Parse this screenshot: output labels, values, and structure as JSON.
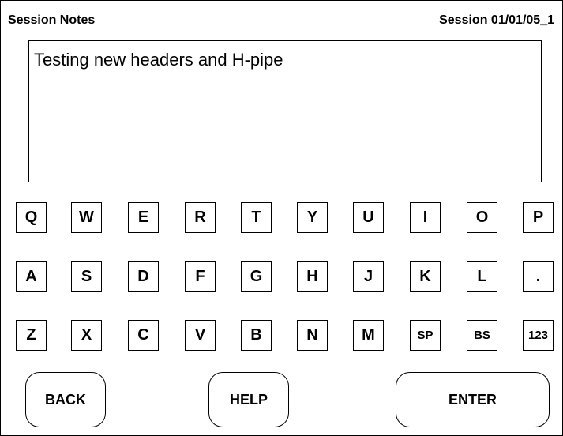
{
  "header": {
    "title": "Session Notes",
    "session": "Session 01/01/05_1"
  },
  "notes": {
    "text": "Testing new headers and H-pipe"
  },
  "keyboard": {
    "rows": [
      [
        "Q",
        "W",
        "E",
        "R",
        "T",
        "Y",
        "U",
        "I",
        "O",
        "P"
      ],
      [
        "A",
        "S",
        "D",
        "F",
        "G",
        "H",
        "J",
        "K",
        "L",
        "."
      ],
      [
        "Z",
        "X",
        "C",
        "V",
        "B",
        "N",
        "M",
        "SP",
        "BS",
        "123"
      ]
    ]
  },
  "buttons": {
    "back": "BACK",
    "help": "HELP",
    "enter": "ENTER"
  }
}
